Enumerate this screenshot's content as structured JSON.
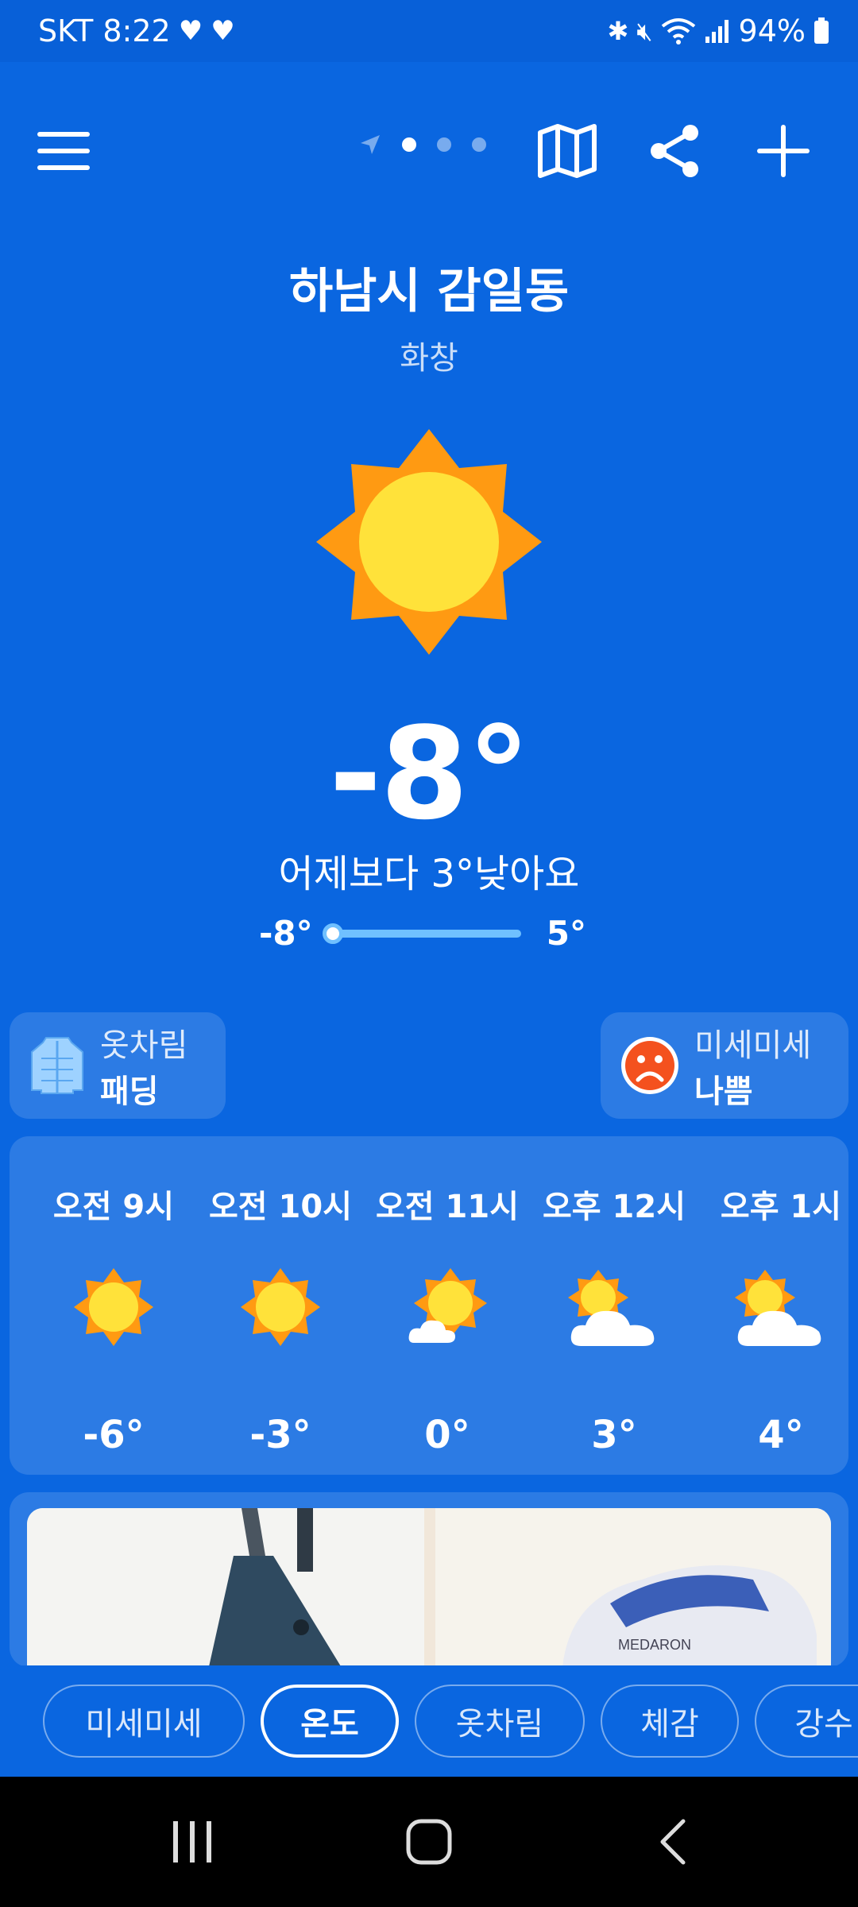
{
  "status": {
    "carrier_time": "SKT 8:22",
    "battery": "94%"
  },
  "location": {
    "name": "하남시 감일동",
    "condition": "화창"
  },
  "current": {
    "temperature": "-8°",
    "comparison": "어제보다 3°낮아요",
    "min": "-8°",
    "max": "5°",
    "position_fraction": 0.0
  },
  "cards": {
    "clothing": {
      "label": "옷차림",
      "value": "패딩"
    },
    "dust": {
      "label": "미세미세",
      "value": "나쁨"
    }
  },
  "hourly": [
    {
      "time": "오전 9시",
      "temp": "-6°",
      "icon": "sun-icon"
    },
    {
      "time": "오전 10시",
      "temp": "-3°",
      "icon": "sun-icon"
    },
    {
      "time": "오전 11시",
      "temp": "0°",
      "icon": "sun-small-cloud-icon"
    },
    {
      "time": "오후 12시",
      "temp": "3°",
      "icon": "partly-cloudy-icon"
    },
    {
      "time": "오후 1시",
      "temp": "4°",
      "icon": "partly-cloudy-icon"
    }
  ],
  "tabs": [
    {
      "label": "미세미세",
      "active": false
    },
    {
      "label": "온도",
      "active": true
    },
    {
      "label": "옷차림",
      "active": false
    },
    {
      "label": "체감",
      "active": false
    },
    {
      "label": "강수",
      "active": false
    }
  ],
  "ad": {
    "text": "MEDARON"
  },
  "colors": {
    "background": "#0a66e0",
    "sun": "#ffe23a",
    "sun_rays": "#ff9a12",
    "track": "#6fc0ff"
  }
}
